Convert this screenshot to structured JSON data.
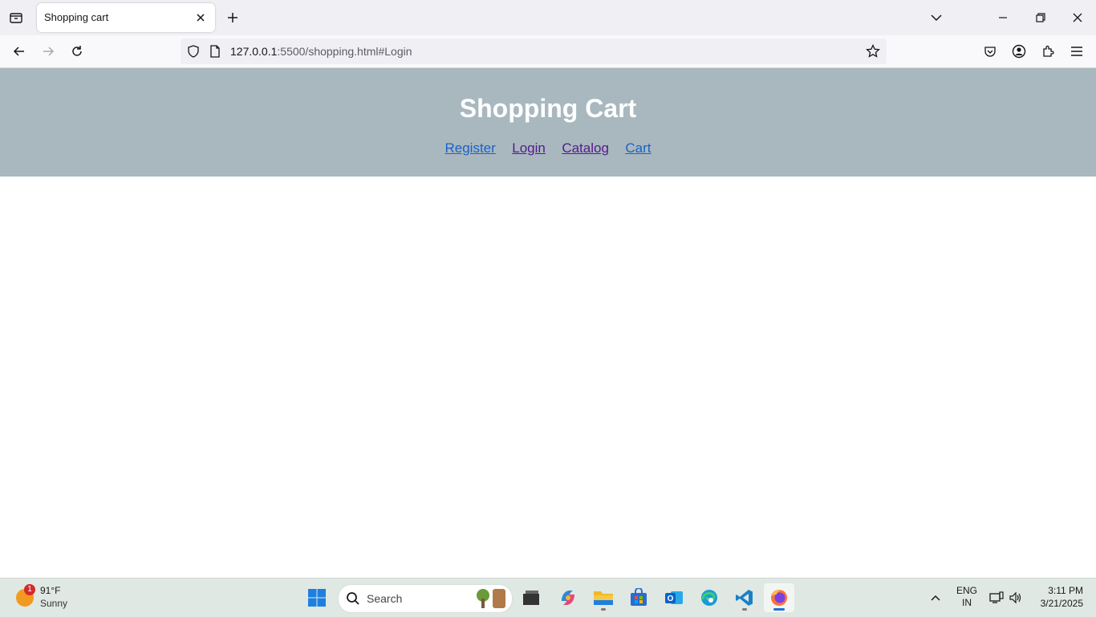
{
  "browser": {
    "tab_title": "Shopping cart",
    "url_host": "127.0.0.1",
    "url_path": ":5500/shopping.html#Login"
  },
  "page": {
    "title": "Shopping Cart",
    "nav": [
      {
        "label": "Register",
        "color": "#1a63c4"
      },
      {
        "label": "Login",
        "color": "#551a8b"
      },
      {
        "label": "Catalog",
        "color": "#551a8b"
      },
      {
        "label": "Cart",
        "color": "#1a63c4"
      }
    ],
    "header_bg": "#a9b8bf"
  },
  "taskbar": {
    "weather": {
      "badge": "1",
      "temp": "91°F",
      "condition": "Sunny"
    },
    "search_label": "Search",
    "lang_line1": "ENG",
    "lang_line2": "IN",
    "time": "3:11 PM",
    "date": "3/21/2025",
    "apps": [
      "start-icon",
      "file-manager-icon",
      "copilot-icon",
      "file-explorer-icon",
      "store-icon",
      "outlook-icon",
      "edge-icon",
      "vscode-icon",
      "firefox-icon"
    ]
  }
}
